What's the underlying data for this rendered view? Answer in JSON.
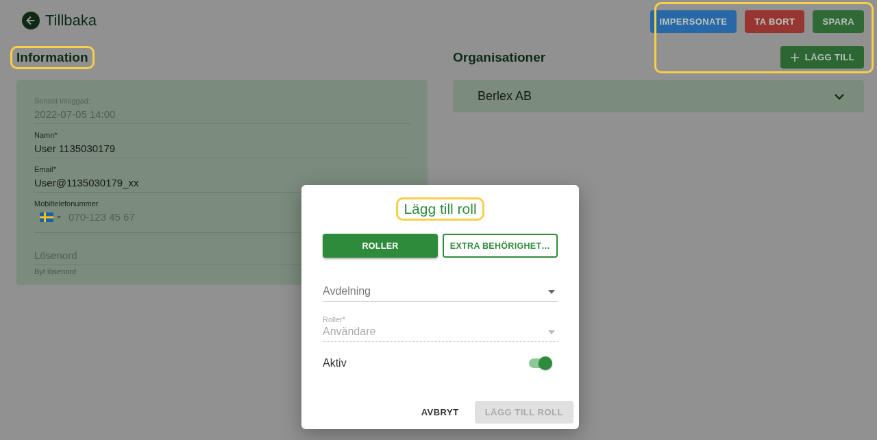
{
  "header": {
    "back_label": "Tillbaka"
  },
  "actions": {
    "highlighted": true,
    "buttons": [
      {
        "label": "IMPERSONATE",
        "color": "#2868a6"
      },
      {
        "label": "TA BORT",
        "color": "#963532"
      },
      {
        "label": "SPARA",
        "color": "#2f6a36"
      }
    ]
  },
  "information": {
    "title": "Information",
    "highlighted": true,
    "fields": [
      {
        "kind": "readonly",
        "label": "Senast inloggad:",
        "value": "2022-07-05 14:00"
      },
      {
        "kind": "text",
        "label": "Namn*",
        "value": "User 1135030179"
      },
      {
        "kind": "text",
        "label": "Email*",
        "value": "User@1135030179_xx"
      },
      {
        "kind": "phone",
        "label": "Mobiltelefonummer",
        "placeholder": "070-123 45 67"
      },
      {
        "kind": "password",
        "placeholder": "Lösenord",
        "helper": "Byt lösenord"
      }
    ]
  },
  "organisations": {
    "title": "Organisationer",
    "add_button": {
      "label": "LÄGG TILL"
    },
    "items": [
      {
        "name": "Berlex AB",
        "expanded": false
      }
    ]
  },
  "dialog": {
    "title": "Lägg till roll",
    "highlighted": true,
    "tabs": [
      {
        "label": "ROLLER",
        "selected": true
      },
      {
        "label": "EXTRA BEHÖRIGHET…",
        "selected": false
      }
    ],
    "fields": [
      {
        "kind": "select",
        "placeholder": "Avdelning",
        "disabled": false
      },
      {
        "kind": "select",
        "label": "Roller*",
        "value": "Användare",
        "disabled": true
      }
    ],
    "switch": {
      "label": "Aktiv",
      "on": true
    },
    "buttons": [
      {
        "label": "AVBRYT",
        "disabled": false
      },
      {
        "label": "LÄGG TILL ROLL",
        "disabled": true
      }
    ]
  }
}
